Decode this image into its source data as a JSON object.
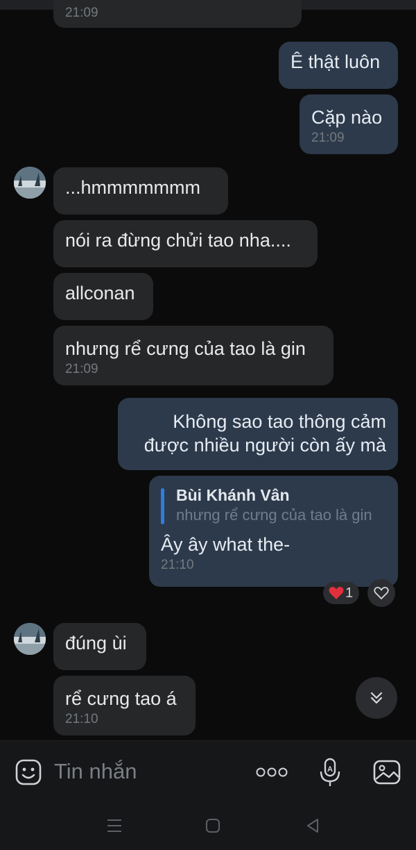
{
  "chat": {
    "top_time": "21:09",
    "messages": [
      {
        "text": "Ê thật luôn"
      },
      {
        "text": "Cặp nào",
        "time": "21:09"
      },
      {
        "text": "...hmmmmmmm"
      },
      {
        "text": "nói ra đừng chửi tao nha...."
      },
      {
        "text": "allconan"
      },
      {
        "text": "nhưng rể cưng của tao là gin",
        "time": "21:09"
      },
      {
        "text_line1": "Không sao tao thông cảm",
        "text_line2": "được nhiều người còn ấy mà"
      },
      {
        "reply_to_name": "Bùi Khánh Vân",
        "reply_to_text": "nhưng rể cưng của tao là gin",
        "text": "Ây ây what the-",
        "time": "21:10",
        "reaction_count": "1"
      },
      {
        "text": "đúng ùi"
      },
      {
        "text": "rể cưng tao á",
        "time": "21:10"
      }
    ]
  },
  "composer": {
    "placeholder": "Tin nhắn",
    "icons": [
      "sticker-icon",
      "more-dots-icon",
      "voice-to-text-icon",
      "image-icon"
    ]
  },
  "navbar": {
    "icons": [
      "menu-icon",
      "home-icon",
      "back-icon"
    ]
  },
  "colors": {
    "background": "#0b0b0c",
    "incoming_bubble": "#262729",
    "outgoing_bubble": "#2d3a4b",
    "reply_accent": "#2f7de0",
    "reaction_heart": "#e0303c"
  }
}
